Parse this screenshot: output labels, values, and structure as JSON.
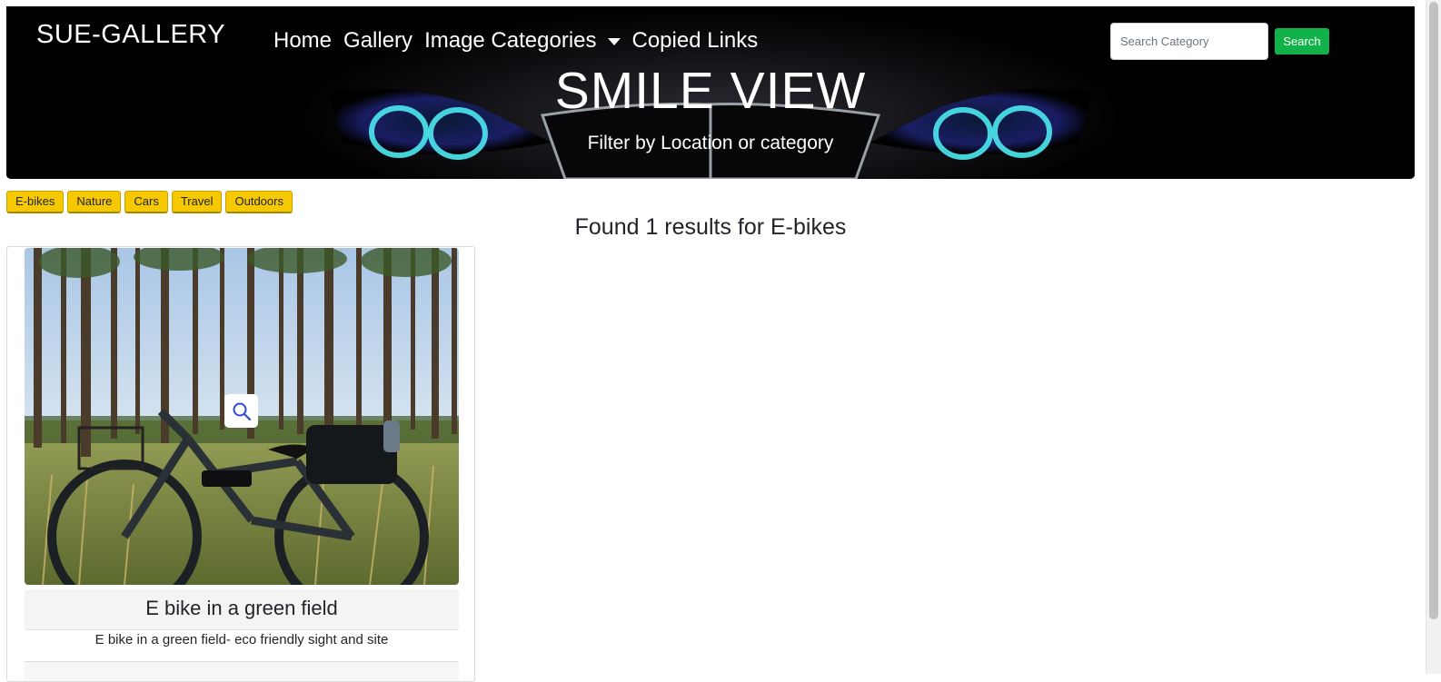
{
  "header": {
    "brand": "SUE-GALLERY",
    "nav": [
      {
        "label": "Home"
      },
      {
        "label": "Gallery"
      },
      {
        "label": "Image Categories",
        "has_dropdown": true
      },
      {
        "label": "Copied Links"
      }
    ],
    "search": {
      "placeholder": "Search Category",
      "value": "",
      "button_label": "Search"
    },
    "hero_title": "SMILE VIEW",
    "hero_subtitle": "Filter by Location or category"
  },
  "filters": [
    "E-bikes",
    "Nature",
    "Cars",
    "Travel",
    "Outdoors"
  ],
  "results_text": "Found 1 results for E-bikes",
  "cards": [
    {
      "title": "E bike in a green field",
      "description": "E bike in a green field- eco friendly sight and site",
      "zoom_icon": "search-icon"
    }
  ],
  "colors": {
    "hero_bg": "#000000",
    "search_button": "#12b24a",
    "filter_chip": "#f5c800",
    "headlight_glow": "#4de8f0"
  }
}
